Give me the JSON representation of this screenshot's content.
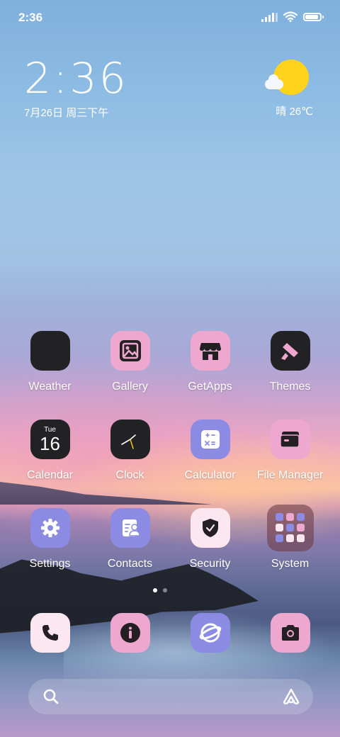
{
  "status_bar": {
    "time": "2:36",
    "battery_percent": 90
  },
  "clock_widget": {
    "time": "2:36",
    "date": "7月26日 周三下午"
  },
  "weather_widget": {
    "condition_temp": "晴 26℃"
  },
  "apps": [
    {
      "label": "Weather",
      "icon": "weather-icon"
    },
    {
      "label": "Gallery",
      "icon": "gallery-icon"
    },
    {
      "label": "GetApps",
      "icon": "getapps-store-icon"
    },
    {
      "label": "Themes",
      "icon": "themes-brush-icon"
    },
    {
      "label": "Calendar",
      "icon": "calendar-icon",
      "day": "Tue",
      "date": "16"
    },
    {
      "label": "Clock",
      "icon": "clock-icon"
    },
    {
      "label": "Calculator",
      "icon": "calculator-icon"
    },
    {
      "label": "File Manager",
      "icon": "folder-icon"
    },
    {
      "label": "Settings",
      "icon": "gear-icon"
    },
    {
      "label": "Contacts",
      "icon": "contacts-icon"
    },
    {
      "label": "Security",
      "icon": "shield-icon"
    },
    {
      "label": "System",
      "icon": "folder-grid-icon"
    }
  ],
  "dock": [
    {
      "icon": "phone-icon"
    },
    {
      "icon": "info-icon"
    },
    {
      "icon": "browser-icon"
    },
    {
      "icon": "camera-icon"
    }
  ],
  "page_indicator": {
    "pages": 2,
    "current": 1
  },
  "colors": {
    "dark_tile": "#222124",
    "pink_tile": "#eea8cf",
    "purple_tile": "#8b8be3",
    "light_tile": "#fce7f0",
    "sun": "#ffd21c"
  }
}
